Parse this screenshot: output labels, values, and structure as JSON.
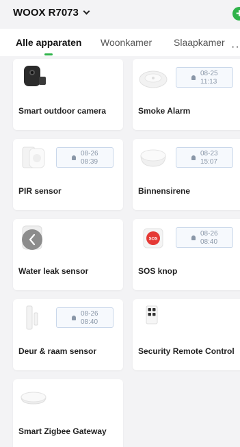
{
  "header": {
    "home_title": "WOOX R7073",
    "add_button": "+"
  },
  "tabs": [
    {
      "label": "Alle apparaten",
      "active": true
    },
    {
      "label": "Woonkamer",
      "active": false
    },
    {
      "label": "Slaapkamer",
      "active": false
    }
  ],
  "more_label": "··",
  "devices": [
    {
      "name": "Smart outdoor camera",
      "icon": "camera-icon"
    },
    {
      "name": "Smoke Alarm",
      "icon": "smoke-alarm-icon",
      "alarm_date": "08-25",
      "alarm_time": "11:13"
    },
    {
      "name": "PIR sensor",
      "icon": "pir-sensor-icon",
      "alarm_date": "08-26",
      "alarm_time": "08:39"
    },
    {
      "name": "Binnensirene",
      "icon": "siren-icon",
      "alarm_date": "08-23",
      "alarm_time": "15:07"
    },
    {
      "name": "Water leak sensor",
      "icon": "water-leak-sensor-icon"
    },
    {
      "name": "SOS knop",
      "icon": "sos-button-icon",
      "icon_text": "SOS",
      "alarm_date": "08-26",
      "alarm_time": "08:40"
    },
    {
      "name": "Deur & raam sensor",
      "icon": "door-window-sensor-icon",
      "alarm_date": "08-26",
      "alarm_time": "08:40"
    },
    {
      "name": "Security Remote Control",
      "icon": "remote-control-icon"
    },
    {
      "name": "Smart Zigbee Gateway",
      "icon": "gateway-icon"
    }
  ],
  "colors": {
    "accent": "#2fb34a",
    "background": "#f3f3f5",
    "card": "#ffffff",
    "alarm_badge_border": "#c9d7ea",
    "sos_red": "#e53935"
  }
}
